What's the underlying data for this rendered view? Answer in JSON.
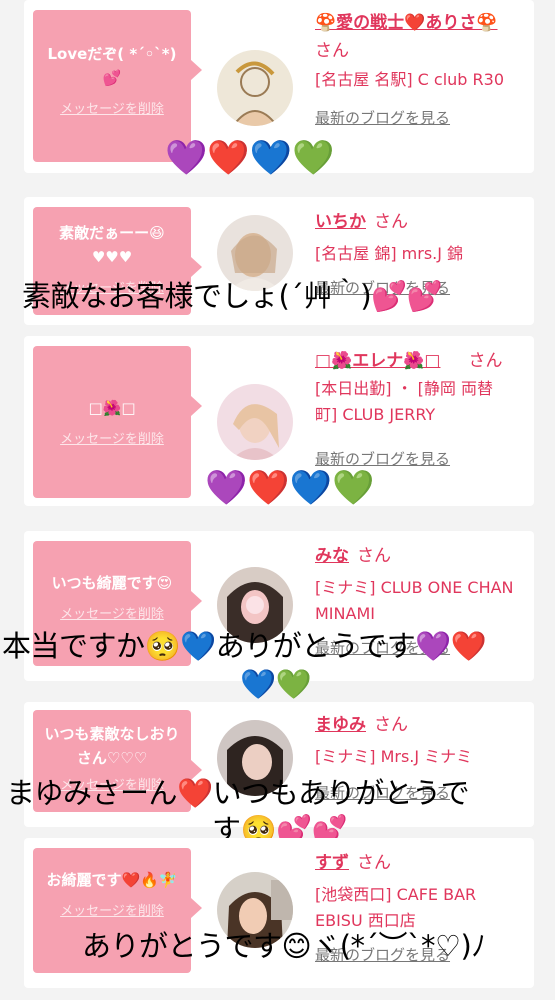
{
  "delete_label": "メッセージを削除",
  "san": "さん",
  "blog_label": "最新のブログを見る",
  "cards": [
    {
      "message": "Loveだぞ( *´◦`*)💕",
      "name": "🍄愛の戦士❤️ありさ🍄",
      "shop": "[名古屋 名駅] C club R30"
    },
    {
      "message": "素敵だぁーー😆♥♥♥",
      "name": "いちか",
      "shop": "[名古屋 錦] mrs.J 錦"
    },
    {
      "message": "□🌺□",
      "name": "□🌺エレナ🌺□",
      "shop": "[本日出勤] ・ [静岡 両替町] CLUB JERRY"
    },
    {
      "message": "いつも綺麗です😍",
      "name": "みな",
      "shop": "[ミナミ] CLUB ONE CHAN MINAMI"
    },
    {
      "message": "いつも素敵なしおりさん♡♡♡",
      "name": "まゆみ",
      "shop": "[ミナミ] Mrs.J ミナミ"
    },
    {
      "message": "お綺麗です❤️🔥🧚",
      "name": "すず",
      "shop": "[池袋西口] CAFE BAR EBISU 西口店"
    }
  ],
  "overlays": {
    "line1": "素敵なお客様でしょ(´艸｀)💕💕",
    "line2": "本当ですか🥺💙ありがとうです💜❤️",
    "line2b": "💙💚",
    "line3": "まゆみさーん❤️いつもありがとうで",
    "line3b": "す🥺💕💕",
    "line4": "ありがとうです😊ヾ(*´︶`*♡)ﾉ",
    "hearts1": "💜❤️💙💚",
    "hearts2": "💜❤️💙💚"
  }
}
